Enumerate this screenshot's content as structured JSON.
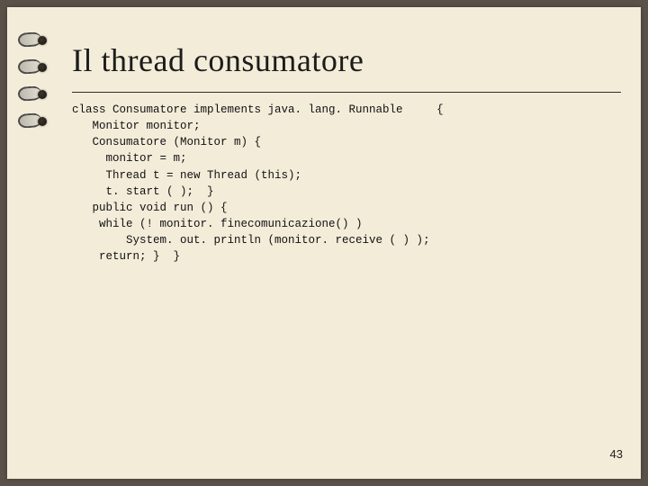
{
  "title": "Il thread consumatore",
  "page_number": "43",
  "code_lines": [
    "class Consumatore implements java. lang. Runnable     {",
    "   Monitor monitor;",
    "   Consumatore (Monitor m) {",
    "     monitor = m;",
    "     Thread t = new Thread (this);",
    "     t. start ( );  }",
    "   public void run () {",
    "    while (! monitor. finecomunicazione() )",
    "        System. out. println (monitor. receive ( ) );",
    "    return; }  }"
  ]
}
